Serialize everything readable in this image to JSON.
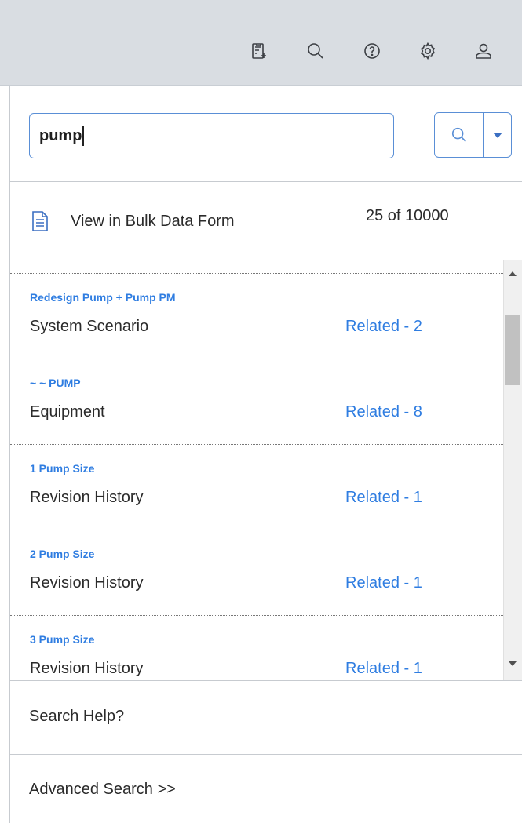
{
  "toolbar": {
    "icons": [
      "new-record-icon",
      "search-icon",
      "help-icon",
      "settings-icon",
      "user-icon"
    ]
  },
  "search": {
    "value": "pump",
    "button_icon": "search-icon",
    "dropdown_icon": "chevron-down-icon"
  },
  "bulk": {
    "label": "View in Bulk Data Form",
    "count": "25 of 10000"
  },
  "results": [
    {
      "title": "Redesign Pump + Pump PM",
      "family": "System Scenario",
      "related": "Related - 2"
    },
    {
      "title": "~ ~ PUMP",
      "family": "Equipment",
      "related": "Related - 8"
    },
    {
      "title": "1 Pump Size",
      "family": "Revision History",
      "related": "Related - 1"
    },
    {
      "title": "2 Pump Size",
      "family": "Revision History",
      "related": "Related - 1"
    },
    {
      "title": "3 Pump Size",
      "family": "Revision History",
      "related": "Related - 1"
    }
  ],
  "footer": {
    "search_help": "Search Help?",
    "advanced_search": "Advanced Search >>"
  },
  "colors": {
    "accent": "#2f7de1",
    "toolbar_bg": "#d9dde2",
    "input_border": "#5a8fd6"
  }
}
